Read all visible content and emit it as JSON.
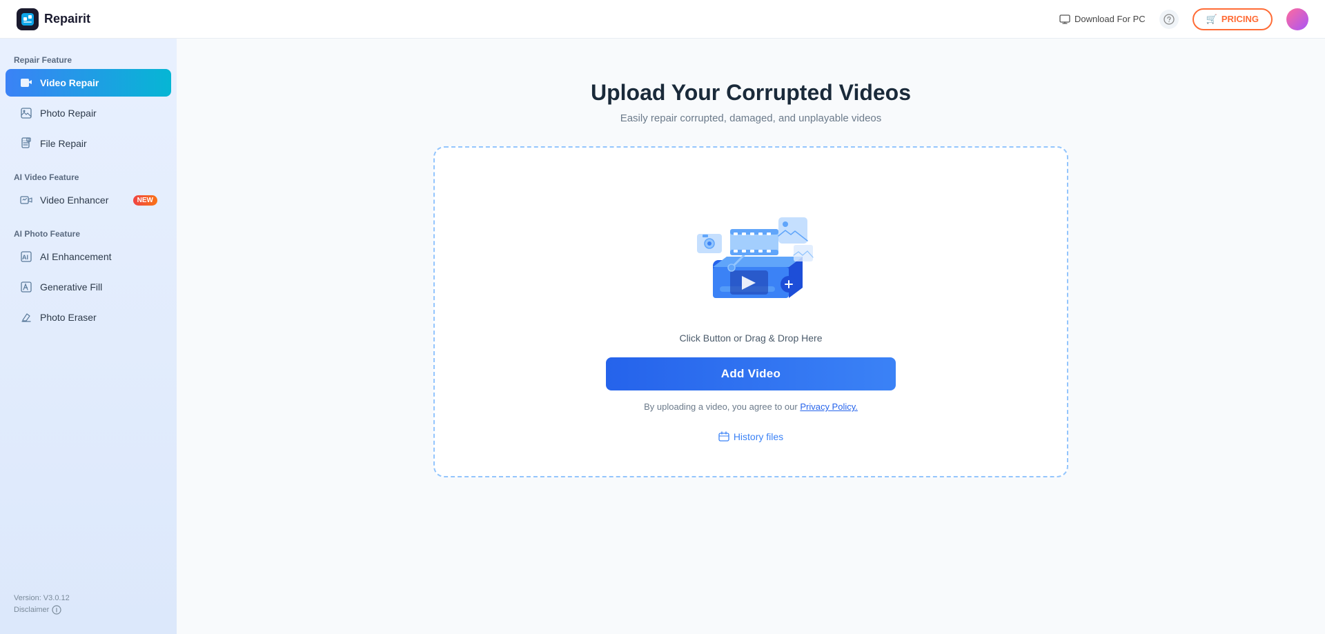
{
  "header": {
    "logo_icon": "R",
    "logo_text": "Repairit",
    "download_label": "Download For PC",
    "pricing_label": "PRICING",
    "pricing_icon": "🛒"
  },
  "sidebar": {
    "repair_feature_label": "Repair Feature",
    "ai_video_feature_label": "AI Video Feature",
    "ai_photo_feature_label": "AI Photo Feature",
    "items": [
      {
        "id": "video-repair",
        "label": "Video Repair",
        "active": true,
        "badge": null
      },
      {
        "id": "photo-repair",
        "label": "Photo Repair",
        "active": false,
        "badge": null
      },
      {
        "id": "file-repair",
        "label": "File Repair",
        "active": false,
        "badge": null
      },
      {
        "id": "video-enhancer",
        "label": "Video Enhancer",
        "active": false,
        "badge": "NEW"
      },
      {
        "id": "ai-enhancement",
        "label": "AI Enhancement",
        "active": false,
        "badge": null
      },
      {
        "id": "generative-fill",
        "label": "Generative Fill",
        "active": false,
        "badge": null
      },
      {
        "id": "photo-eraser",
        "label": "Photo Eraser",
        "active": false,
        "badge": null
      }
    ],
    "version_label": "Version: V3.0.12",
    "disclaimer_label": "Disclaimer"
  },
  "main": {
    "title": "Upload Your Corrupted Videos",
    "subtitle": "Easily repair corrupted, damaged, and unplayable videos",
    "drag_drop_hint": "Click Button or Drag & Drop Here",
    "add_video_label": "Add Video",
    "privacy_text_prefix": "By uploading a video, you agree to our ",
    "privacy_policy_label": "Privacy Policy.",
    "history_label": "History files"
  }
}
